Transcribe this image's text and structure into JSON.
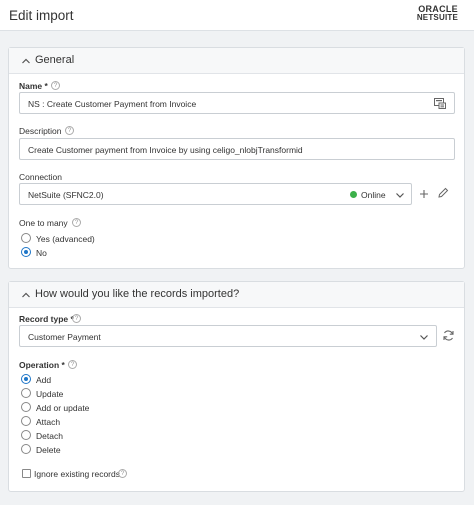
{
  "header": {
    "title": "Edit import",
    "logo_top": "ORACLE",
    "logo_bottom": "NETSUITE"
  },
  "general": {
    "title": "General",
    "name_label": "Name *",
    "name_value": "NS : Create Customer Payment from Invoice",
    "description_label": "Description",
    "description_value": "Create Customer payment from Invoice by using celigo_nlobjTransformid",
    "connection_label": "Connection",
    "connection_value": "NetSuite (SFNC2.0)",
    "connection_status": "Online",
    "status_color": "#3cb04a",
    "one_to_many_label": "One to many",
    "one_to_many_options": [
      {
        "label": "Yes (advanced)",
        "selected": false
      },
      {
        "label": "No",
        "selected": true
      }
    ]
  },
  "records": {
    "title": "How would you like the records imported?",
    "record_type_label": "Record type *",
    "record_type_value": "Customer Payment",
    "operation_label": "Operation *",
    "operations": [
      {
        "label": "Add",
        "selected": true
      },
      {
        "label": "Update",
        "selected": false
      },
      {
        "label": "Add or update",
        "selected": false
      },
      {
        "label": "Attach",
        "selected": false
      },
      {
        "label": "Detach",
        "selected": false
      },
      {
        "label": "Delete",
        "selected": false
      }
    ],
    "ignore_label": "Ignore existing records"
  },
  "colors": {
    "accent": "#1e76c8"
  }
}
